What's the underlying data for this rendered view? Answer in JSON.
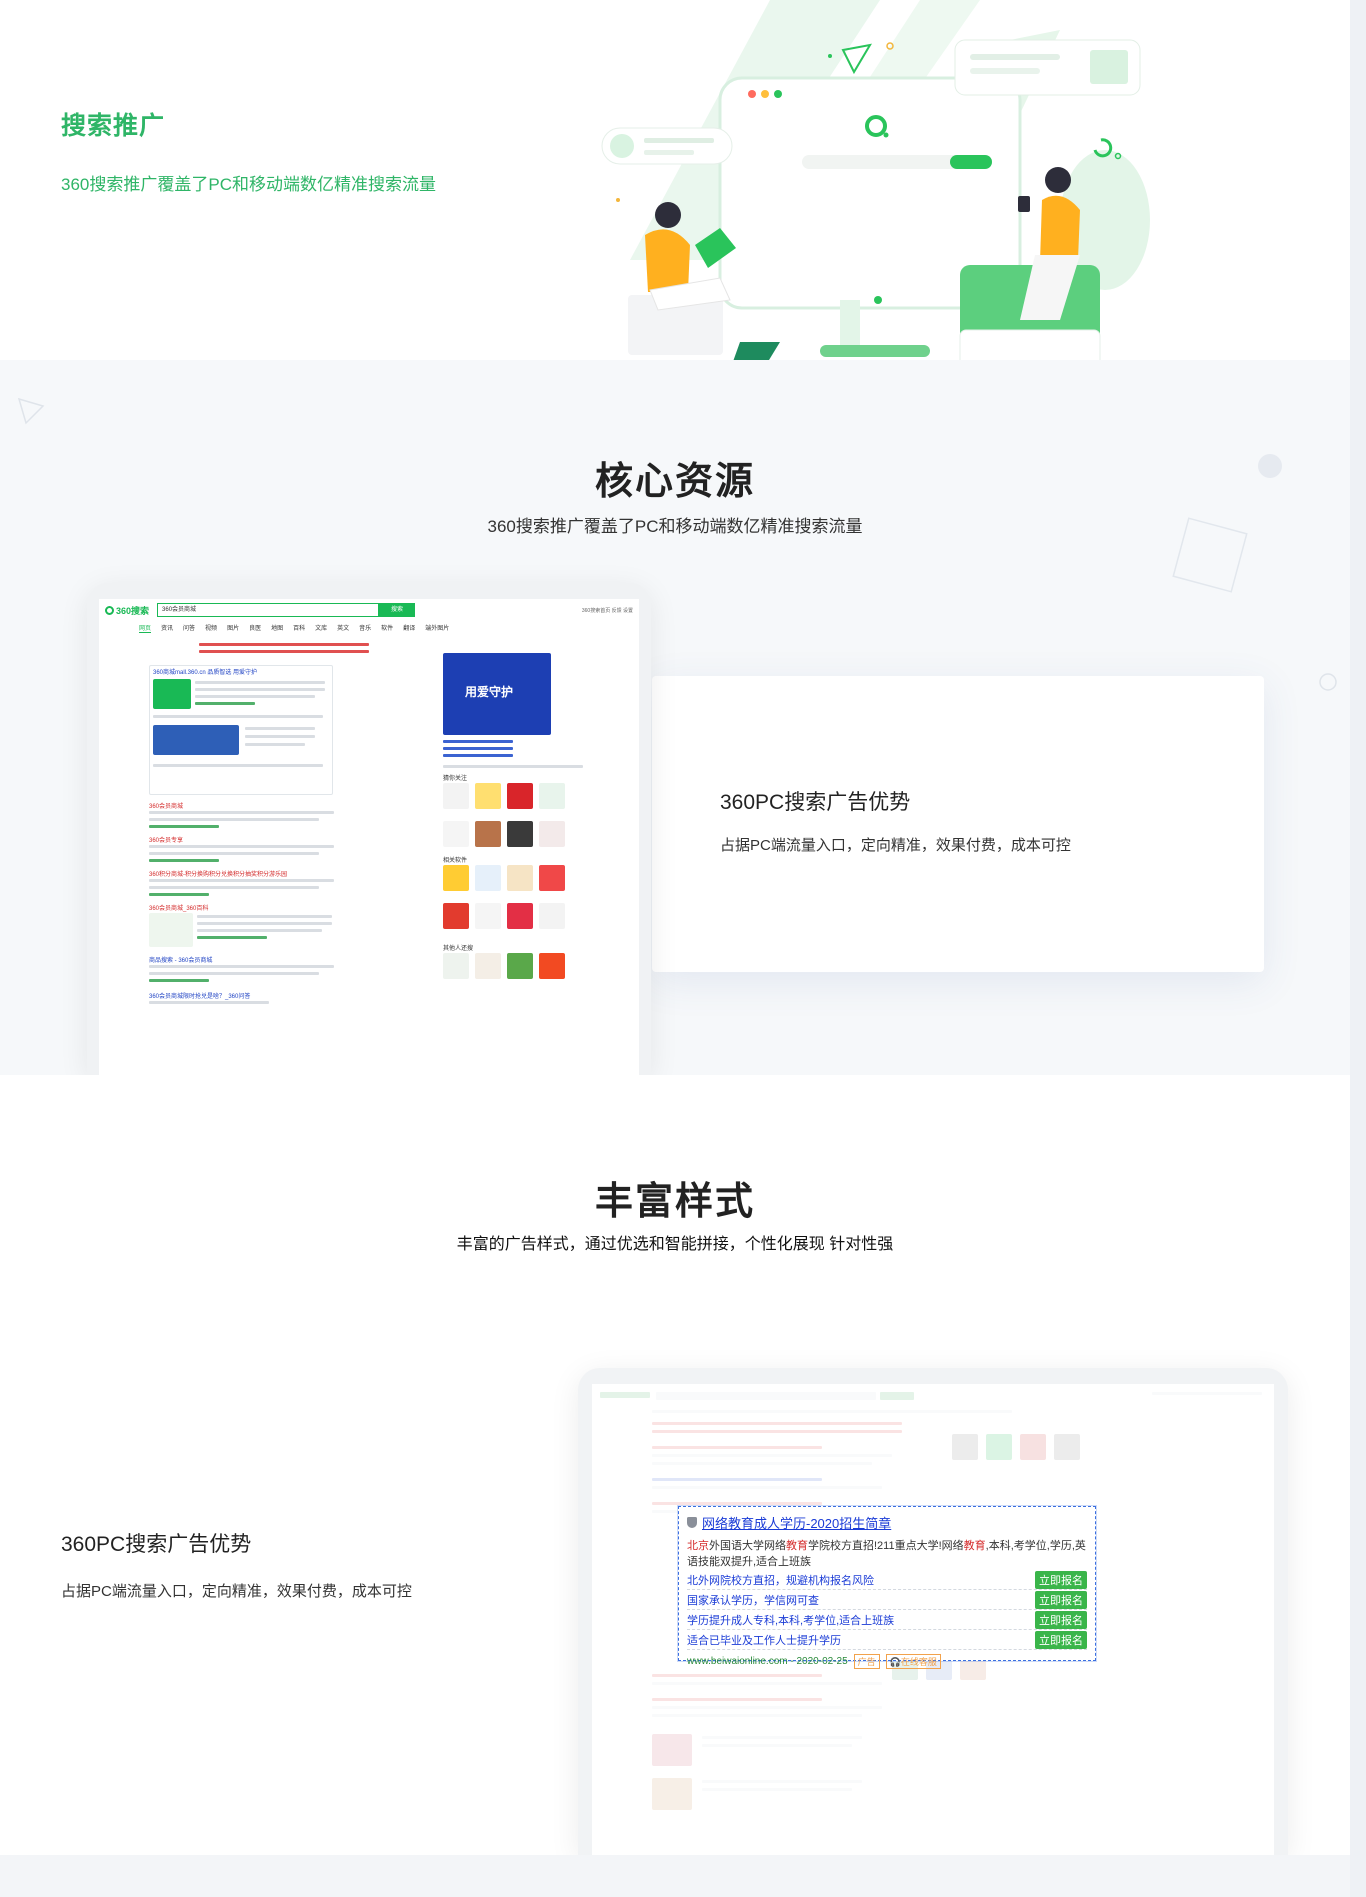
{
  "hero": {
    "title": "搜索推广",
    "subtitle": "360搜索推广覆盖了PC和移动端数亿精准搜索流量"
  },
  "section1": {
    "title": "核心资源",
    "subtitle": "360搜索推广覆盖了PC和移动端数亿精准搜索流量",
    "card_title": "360PC搜索广告优势",
    "card_desc": "占据PC端流量入口，定向精准，效果付费，成本可控",
    "mock_search": {
      "logo": "360搜索",
      "query": "360会员商城",
      "button": "搜索",
      "top_right": "360搜索首页  反馈  设置",
      "tabs": [
        "网页",
        "资讯",
        "问答",
        "视频",
        "图片",
        "良医",
        "地图",
        "百科",
        "文库",
        "英文",
        "音乐",
        "软件",
        "翻译",
        "端外图片"
      ],
      "result_titles": [
        "360商城mall.360.cn 品质智选 用爱守护",
        "360会员商城",
        "360会员专享",
        "360积分商城-积分换购积分兑换积分抽奖积分游乐园",
        "360会员商城_360百科",
        "商品搜索 - 360会员商城",
        "360会员商城限时抢兑是啥？_360问答"
      ],
      "side_banner": "用爱守护",
      "side_section_labels": [
        "猜你关注",
        "相关软件",
        "其他人还搜"
      ]
    }
  },
  "section2": {
    "title": "丰富样式",
    "subtitle": "丰富的广告样式，通过优选和智能拼接，个性化展现 针对性强",
    "card_title": "360PC搜索广告优势",
    "card_desc": "占据PC端流量入口，定向精准，效果付费，成本可控",
    "ad": {
      "title": "网络教育成人学历-2020招生简章",
      "desc_parts": [
        "北京",
        "外国语大学网络",
        "教育",
        "学院校方直招!211重点大学!网络",
        "教育",
        ",本科,考学位,学历,英语技能双提升,适合上班族"
      ],
      "rows": [
        {
          "text": "北外网院校方直招，规避机构报名风险",
          "cta": "立即报名"
        },
        {
          "text": "国家承认学历，学信网可查",
          "cta": "立即报名"
        },
        {
          "text": "学历提升成人专科,本科,考学位,适合上班族",
          "cta": "立即报名"
        },
        {
          "text": "适合已毕业及工作人士提升学历",
          "cta": "立即报名"
        }
      ],
      "url": "www.beiwaionline.com - 2020-02-25",
      "tag": "广告",
      "kefu": "在线客服"
    }
  },
  "colors": {
    "brand_green": "#2fb567",
    "search_green": "#19b955",
    "ad_link_blue": "#1a3bd6",
    "ad_red": "#d42b2b",
    "cta_green": "#3ab54a",
    "section_bg": "#f6f8fa"
  }
}
